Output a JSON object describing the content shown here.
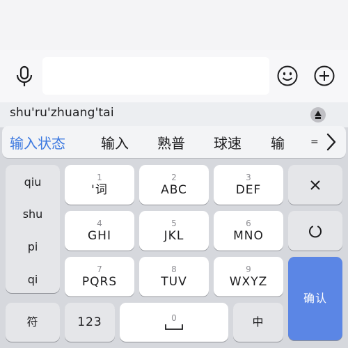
{
  "composition": {
    "pinyin": "shu'ru'zhuang'tai"
  },
  "candidates": {
    "items": [
      "输入状态",
      "输入",
      "熟普",
      "球速",
      "输"
    ],
    "more": "="
  },
  "side_list": {
    "items": [
      "qiu",
      "shu",
      "pi",
      "qi"
    ]
  },
  "keys": {
    "k1": {
      "num": "1",
      "label": "'词"
    },
    "k2": {
      "num": "2",
      "label": "ABC"
    },
    "k3": {
      "num": "3",
      "label": "DEF"
    },
    "k4": {
      "num": "4",
      "label": "GHI"
    },
    "k5": {
      "num": "5",
      "label": "JKL"
    },
    "k6": {
      "num": "6",
      "label": "MNO"
    },
    "k7": {
      "num": "7",
      "label": "PQRS"
    },
    "k8": {
      "num": "8",
      "label": "TUV"
    },
    "k9": {
      "num": "9",
      "label": "WXYZ"
    },
    "k0": {
      "num": "0"
    },
    "symbol": "符",
    "numbers": "123",
    "lang": "中",
    "confirm": "确认"
  },
  "icons": {
    "mic": "microphone-icon",
    "emoji": "emoji-icon",
    "plus": "plus-circle-icon",
    "delete": "close-icon",
    "reset": "circle-reset-icon",
    "space": "space-bar-icon",
    "more": "chevron-right-icon",
    "switch": "keyboard-switch-icon"
  },
  "colors": {
    "accent": "#3b78e0",
    "confirm_key": "#5b86e5",
    "keyboard_bg": "#d6d8dd"
  }
}
